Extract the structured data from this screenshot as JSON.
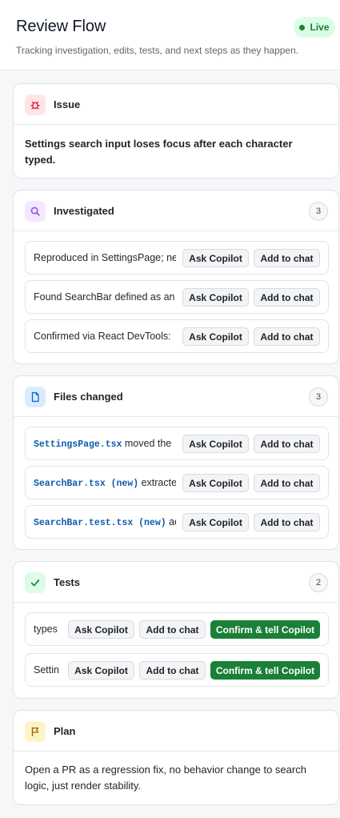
{
  "header": {
    "title": "Review Flow",
    "subtitle": "Tracking investigation, edits, tests, and next steps as they happen.",
    "badge": "Live"
  },
  "issue": {
    "title": "Issue",
    "text": "Settings search input loses focus after each character typed."
  },
  "investigated": {
    "title": "Investigated",
    "count": "3",
    "items": [
      {
        "text": "Reproduced in SettingsPage; ne"
      },
      {
        "text": "Found SearchBar defined as an"
      },
      {
        "text": "Confirmed via React DevTools:"
      }
    ]
  },
  "files_changed": {
    "title": "Files changed",
    "count": "3",
    "items": [
      {
        "file": "SettingsPage.tsx",
        "text": " moved the"
      },
      {
        "file": "SearchBar.tsx (new)",
        "text": " extracte"
      },
      {
        "file": "SearchBar.test.tsx (new)",
        "text": " ad"
      }
    ]
  },
  "tests": {
    "title": "Tests",
    "count": "2",
    "items": [
      {
        "text": "types"
      },
      {
        "text": "Settin"
      }
    ]
  },
  "plan": {
    "title": "Plan",
    "text": "Open a PR as a regression fix, no behavior change to search logic, just render stability."
  },
  "actions": {
    "ask_copilot": "Ask Copilot",
    "add_to_chat": "Add to chat",
    "confirm": "Confirm & tell Copilot"
  },
  "colors": {
    "accent_green": "#1a7f37",
    "issue_icon": "#cf222e",
    "investigated_icon": "#8250df",
    "files_icon": "#0969da",
    "tests_icon": "#1a7f37",
    "plan_icon": "#9a6700"
  }
}
